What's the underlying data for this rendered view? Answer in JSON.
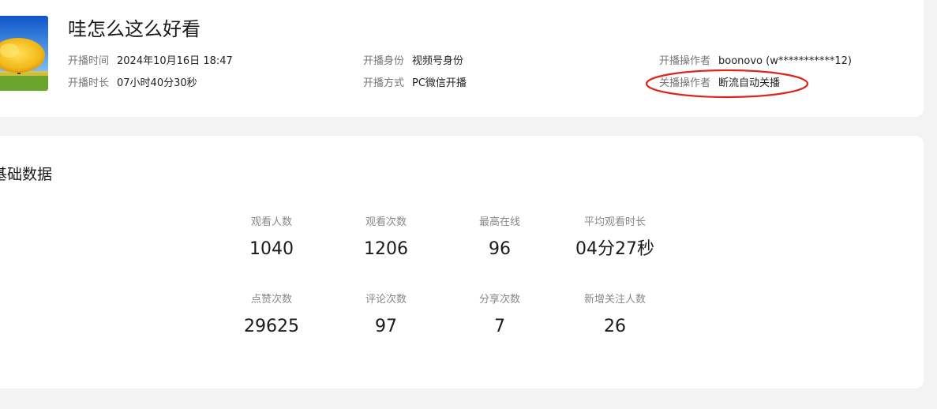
{
  "live": {
    "title": "哇怎么这么好看",
    "cover_icon": "tree-landscape-icon"
  },
  "meta": {
    "start_time": {
      "label": "开播时间",
      "value": "2024年10月16日 18:47"
    },
    "duration": {
      "label": "开播时长",
      "value": "07小时40分30秒"
    },
    "identity": {
      "label": "开播身份",
      "value": "视频号身份"
    },
    "method": {
      "label": "开播方式",
      "value": "PC微信开播"
    },
    "start_operator": {
      "label": "开播操作者",
      "value": "boonovo (w***********12)"
    },
    "end_operator": {
      "label": "关播操作者",
      "value": "断流自动关播"
    }
  },
  "section": {
    "title": "基础数据"
  },
  "stats": [
    {
      "label": "观看人数",
      "value": "1040"
    },
    {
      "label": "观看次数",
      "value": "1206"
    },
    {
      "label": "最高在线",
      "value": "96"
    },
    {
      "label": "平均观看时长",
      "value": "04分27秒"
    },
    {
      "label": "点赞次数",
      "value": "29625"
    },
    {
      "label": "评论次数",
      "value": "97"
    },
    {
      "label": "分享次数",
      "value": "7"
    },
    {
      "label": "新增关注人数",
      "value": "26"
    }
  ],
  "colors": {
    "background": "#f3f3f3",
    "card": "#ffffff",
    "annotation": "#e0241c"
  }
}
